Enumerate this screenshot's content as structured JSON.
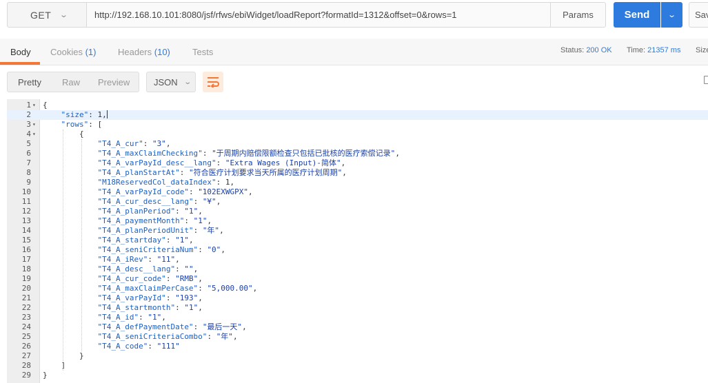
{
  "request": {
    "method": "GET",
    "url": "http://192.168.10.101:8080/jsf/rfws/ebiWidget/loadReport?formatId=1312&offset=0&rows=1",
    "params_label": "Params",
    "send_label": "Send",
    "save_label": "Sav"
  },
  "response_tabs": {
    "body": "Body",
    "cookies": "Cookies",
    "cookies_count": "(1)",
    "headers": "Headers",
    "headers_count": "(10)",
    "tests": "Tests"
  },
  "status": {
    "status_label": "Status:",
    "status_value": "200 OK",
    "time_label": "Time:",
    "time_value": "21357 ms",
    "size_label": "Size"
  },
  "view": {
    "pretty": "Pretty",
    "raw": "Raw",
    "preview": "Preview",
    "format": "JSON"
  },
  "colors": {
    "accent": "#2e7be0",
    "tab_underline": "#f27935"
  },
  "json_lines": [
    "{",
    "    \"size\": 1,",
    "    \"rows\": [",
    "        {",
    "            \"T4_A_cur\": \"3\",",
    "            \"T4_A_maxClaimChecking\": \"于周期内赔偿限额检查只包括已批核的医疗索偿记录\",",
    "            \"T4_A_varPayId_desc__lang\": \"Extra Wages (Input)-简体\",",
    "            \"T4_A_planStartAt\": \"符合医疗计划要求当天所属的医疗计划周期\",",
    "            \"M18ReservedCol_dataIndex\": 1,",
    "            \"T4_A_varPayId_code\": \"102EXWGPX\",",
    "            \"T4_A_cur_desc__lang\": \"¥\",",
    "            \"T4_A_planPeriod\": \"1\",",
    "            \"T4_A_paymentMonth\": \"1\",",
    "            \"T4_A_planPeriodUnit\": \"年\",",
    "            \"T4_A_startday\": \"1\",",
    "            \"T4_A_seniCriteriaNum\": \"0\",",
    "            \"T4_A_iRev\": \"11\",",
    "            \"T4_A_desc__lang\": \"\",",
    "            \"T4_A_cur_code\": \"RMB\",",
    "            \"T4_A_maxClaimPerCase\": \"5,000.00\",",
    "            \"T4_A_varPayId\": \"193\",",
    "            \"T4_A_startmonth\": \"1\",",
    "            \"T4_A_id\": \"1\",",
    "            \"T4_A_defPaymentDate\": \"最后一天\",",
    "            \"T4_A_seniCriteriaCombo\": \"年\",",
    "            \"T4_A_code\": \"111\"",
    "        }",
    "    ]",
    "}"
  ],
  "fold_lines": [
    1,
    3,
    4
  ]
}
